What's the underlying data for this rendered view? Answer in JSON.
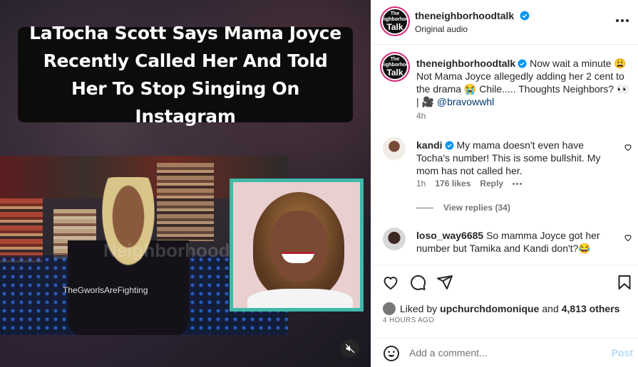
{
  "media": {
    "headline": "LaTocha Scott Says Mama Joyce Recently Called Her And Told Her To Stop Singing On Instagram",
    "video_watermark": "TheGworlsAreFighting",
    "big_watermark": "Neighborhood Talk"
  },
  "post": {
    "author": "theneighborhoodtalk",
    "author_logo_top": "The Neighborhood",
    "author_logo_main": "Talk",
    "audio": "Original audio",
    "caption": {
      "text": "Now wait a minute 😩 Not Mama Joyce allegedly adding her 2 cent to the drama 😭 Chile..... Thoughts Neighbors? 👀 | 🎥",
      "mention": "@bravowwhl",
      "time": "4h"
    },
    "comments": [
      {
        "user": "kandi",
        "text": "My mama doesn't even have Tocha's number! This is some bullshit. My mom has not called her.",
        "time": "1h",
        "likes": "176 likes",
        "reply": "Reply",
        "view_replies": "View replies (34)"
      },
      {
        "user": "loso_way6685",
        "text": "So mamma Joyce got her number but Tamika and Kandi don't?😂"
      }
    ],
    "liked_by_prefix": "Liked by",
    "liked_by_user": "upchurchdomonique",
    "liked_by_and": "and",
    "liked_by_others": "4,813 others",
    "posted_ago": "4 HOURS AGO",
    "comment_placeholder": "Add a comment...",
    "post_label": "Post"
  },
  "colors": {
    "verified": "#0095f6",
    "ring": "#d62976",
    "portrait_border": "#3fb8a8",
    "post_disabled": "#b3dbff"
  },
  "icons": [
    "verified-badge-icon",
    "more-options-icon",
    "heart-icon",
    "comment-icon",
    "share-icon",
    "bookmark-icon",
    "emoji-icon",
    "mute-icon"
  ]
}
